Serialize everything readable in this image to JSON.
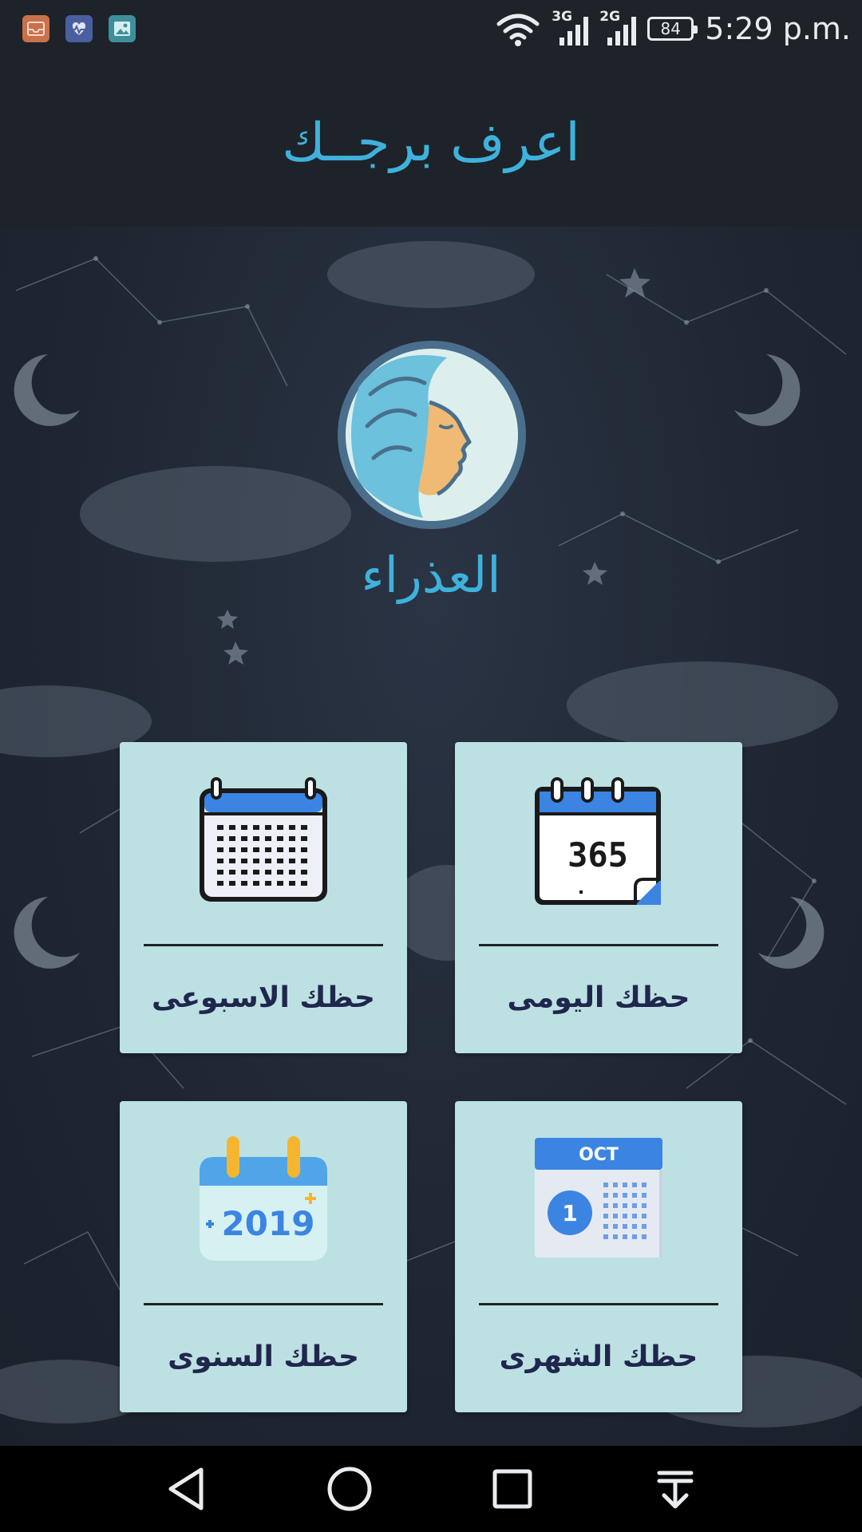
{
  "status_bar": {
    "notification_icons": [
      {
        "name": "inbox-icon",
        "color": "#c9714a"
      },
      {
        "name": "health-icon",
        "color": "#4a5f9e"
      },
      {
        "name": "gallery-icon",
        "color": "#3f8f9a"
      }
    ],
    "network_1": "3G",
    "network_2": "2G",
    "battery": "84",
    "time": "5:29 p.m."
  },
  "app_bar": {
    "title": "اعرف برجــك"
  },
  "sign": {
    "name": "العذراء",
    "icon": "virgo-woman-icon"
  },
  "cards": {
    "daily": {
      "label": "حظك اليومى",
      "icon": "calendar-365-icon",
      "icon_text": "365"
    },
    "weekly": {
      "label": "حظك الاسبوعى",
      "icon": "calendar-grid-icon"
    },
    "monthly": {
      "label": "حظك الشهرى",
      "icon": "calendar-month-icon",
      "month": "OCT",
      "day": "1"
    },
    "yearly": {
      "label": "حظك السنوى",
      "icon": "calendar-year-icon",
      "year": "2019"
    }
  },
  "nav_bar": {
    "buttons": [
      "back-icon",
      "home-icon",
      "recents-icon",
      "notification-pulldown-icon"
    ]
  },
  "colors": {
    "accent": "#3fb1dc",
    "card_bg": "#bde1e2",
    "card_text": "#20264e",
    "bar_bg": "#1d2329"
  }
}
